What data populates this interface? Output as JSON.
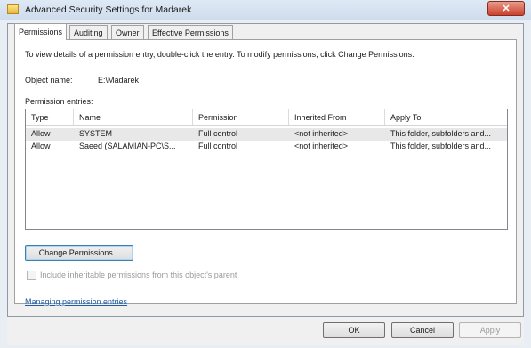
{
  "window": {
    "title": "Advanced Security Settings for Madarek",
    "close_label": "✕"
  },
  "tabs": [
    {
      "label": "Permissions",
      "active": true
    },
    {
      "label": "Auditing",
      "active": false
    },
    {
      "label": "Owner",
      "active": false
    },
    {
      "label": "Effective Permissions",
      "active": false
    }
  ],
  "permissions": {
    "instructions": "To view details of a permission entry, double-click the entry. To modify permissions, click Change Permissions.",
    "object_name_label": "Object name:",
    "object_name_value": "E:\\Madarek",
    "entries_label": "Permission entries:",
    "columns": [
      "Type",
      "Name",
      "Permission",
      "Inherited From",
      "Apply To"
    ],
    "rows": [
      {
        "type": "Allow",
        "name": "SYSTEM",
        "permission": "Full control",
        "inherited_from": "<not inherited>",
        "apply_to": "This folder, subfolders and..."
      },
      {
        "type": "Allow",
        "name": "Saeed (SALAMIAN-PC\\S...",
        "permission": "Full control",
        "inherited_from": "<not inherited>",
        "apply_to": "This folder, subfolders and..."
      }
    ],
    "change_button_label": "Change Permissions...",
    "include_inheritable_label": "Include inheritable permissions from this object's parent",
    "include_inheritable_checked": false,
    "managing_link_label": "Managing permission entries"
  },
  "buttons": {
    "ok": "OK",
    "cancel": "Cancel",
    "apply": "Apply"
  }
}
